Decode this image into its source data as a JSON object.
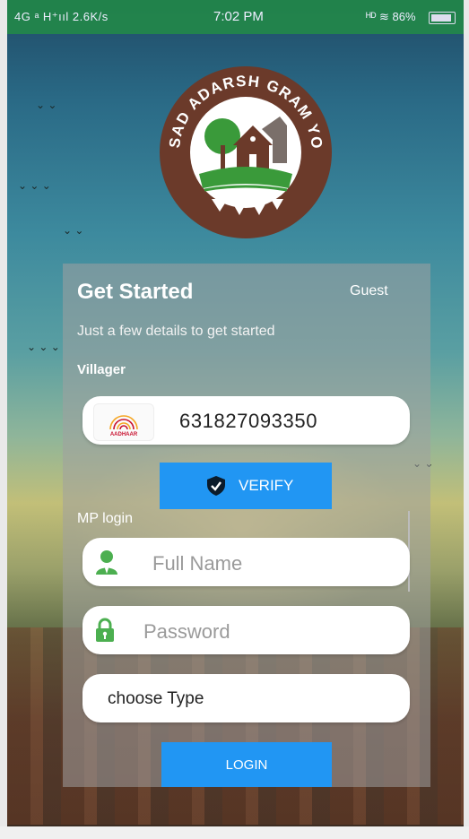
{
  "status_bar": {
    "network_left": "4G ᵃ  H⁺ııl 2.6K/s",
    "time": "7:02 PM",
    "network_right": "ᴴᴰ ≋ 86%"
  },
  "logo": {
    "text": "SAANSAD ADARSH GRAM YOJANA"
  },
  "card": {
    "title": "Get Started",
    "guest_label": "Guest",
    "subtitle": "Just a few details to get started",
    "villager_label": "Villager",
    "aadhaar": {
      "logo_text": "AADHAAR",
      "value": "631827093350"
    },
    "verify_label": "VERIFY",
    "mp_login_label": "MP login",
    "full_name": {
      "placeholder": "Full Name",
      "value": ""
    },
    "password": {
      "placeholder": "Password",
      "value": ""
    },
    "choose_type": "choose Type",
    "login_label": "LOGIN"
  },
  "icons": {
    "aadhaar": "aadhaar-icon",
    "shield": "shield-check-icon",
    "user": "user-icon",
    "lock": "lock-icon",
    "battery": "battery-icon"
  },
  "colors": {
    "accent": "#2196f3",
    "status_bar": "#228c46",
    "icon_green": "#4caf50",
    "logo_brown": "#6b3a2a"
  }
}
